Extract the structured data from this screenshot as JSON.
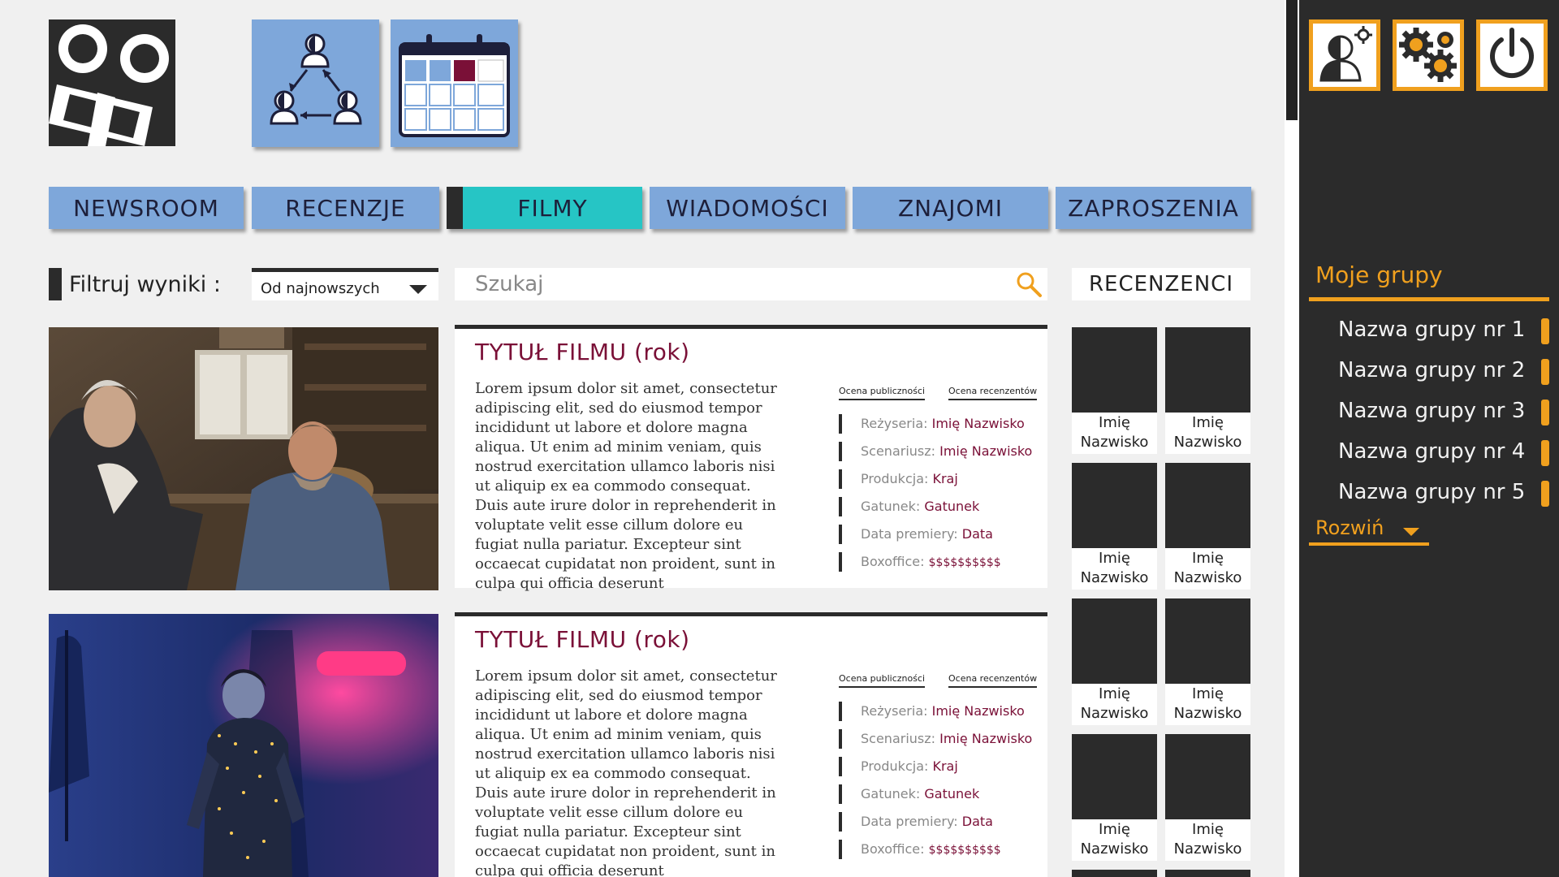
{
  "colors": {
    "nav_blue": "#7ea7da",
    "active_teal": "#26c5c5",
    "dark": "#2b2b2b",
    "accent_orange": "#f0a01e",
    "maroon": "#7a1037",
    "bg": "#f0f0f0"
  },
  "header": {
    "logo_icon": "film-camera-logo-icon",
    "apps": [
      {
        "icon": "group-triangle-icon"
      },
      {
        "icon": "calendar-icon"
      }
    ]
  },
  "nav": {
    "items": [
      "NEWSROOM",
      "RECENZJE",
      "FILMY",
      "WIADOMOŚCI",
      "ZNAJOMI",
      "ZAPROSZENIA"
    ],
    "active": "FILMY"
  },
  "filter": {
    "label": "Filtruj wyniki :",
    "selected": "Od najnowszych"
  },
  "search": {
    "placeholder": "Szukaj",
    "icon": "search-icon"
  },
  "reviewers": {
    "title": "RECENZENCI",
    "items": [
      {
        "first": "Imię",
        "last": "Nazwisko"
      },
      {
        "first": "Imię",
        "last": "Nazwisko"
      },
      {
        "first": "Imię",
        "last": "Nazwisko"
      },
      {
        "first": "Imię",
        "last": "Nazwisko"
      },
      {
        "first": "Imię",
        "last": "Nazwisko"
      },
      {
        "first": "Imię",
        "last": "Nazwisko"
      },
      {
        "first": "Imię",
        "last": "Nazwisko"
      },
      {
        "first": "Imię",
        "last": "Nazwisko"
      }
    ]
  },
  "films": [
    {
      "title": "TYTUŁ FILMU",
      "year": "(rok)",
      "description": "Lorem ipsum dolor sit amet, consectetur adipiscing elit, sed do eiusmod tempor incididunt ut labore et dolore magna aliqua. Ut enim ad minim veniam, quis nostrud exercitation ullamco laboris nisi ut aliquip ex ea commodo consequat. Duis aute irure dolor in reprehenderit in voluptate velit esse cillum dolore eu fugiat nulla pariatur. Excepteur sint occaecat cupidatat non proident, sunt in culpa qui officia deserunt",
      "rating_audience": "Ocena publiczności",
      "rating_critics": "Ocena recenzentów",
      "meta": [
        {
          "key": "Reżyseria:",
          "value": "Imię Nazwisko"
        },
        {
          "key": "Scenariusz:",
          "value": "Imię Nazwisko"
        },
        {
          "key": "Produkcja:",
          "value": "Kraj"
        },
        {
          "key": "Gatunek:",
          "value": "Gatunek"
        },
        {
          "key": "Data premiery:",
          "value": "Data"
        },
        {
          "key": "Boxoffice:",
          "value": "$$$$$$$$$$"
        }
      ]
    },
    {
      "title": "TYTUŁ FILMU",
      "year": "(rok)",
      "description": "Lorem ipsum dolor sit amet, consectetur adipiscing elit, sed do eiusmod tempor incididunt ut labore et dolore magna aliqua. Ut enim ad minim veniam, quis nostrud exercitation ullamco laboris nisi ut aliquip ex ea commodo consequat. Duis aute irure dolor in reprehenderit in voluptate velit esse cillum dolore eu fugiat nulla pariatur. Excepteur sint occaecat cupidatat non proident, sunt in culpa qui officia deserunt",
      "rating_audience": "Ocena publiczności",
      "rating_critics": "Ocena recenzentów",
      "meta": [
        {
          "key": "Reżyseria:",
          "value": "Imię Nazwisko"
        },
        {
          "key": "Scenariusz:",
          "value": "Imię Nazwisko"
        },
        {
          "key": "Produkcja:",
          "value": "Kraj"
        },
        {
          "key": "Gatunek:",
          "value": "Gatunek"
        },
        {
          "key": "Data premiery:",
          "value": "Data"
        },
        {
          "key": "Boxoffice:",
          "value": "$$$$$$$$$$"
        }
      ]
    }
  ],
  "sidebar": {
    "buttons": [
      {
        "icon": "user-settings-icon"
      },
      {
        "icon": "gears-icon"
      },
      {
        "icon": "power-icon"
      }
    ],
    "groups_title": "Moje grupy",
    "groups": [
      "Nazwa grupy nr 1",
      "Nazwa grupy nr 2",
      "Nazwa grupy nr 3",
      "Nazwa grupy nr 4",
      "Nazwa grupy nr 5"
    ],
    "expand_label": "Rozwiń"
  }
}
